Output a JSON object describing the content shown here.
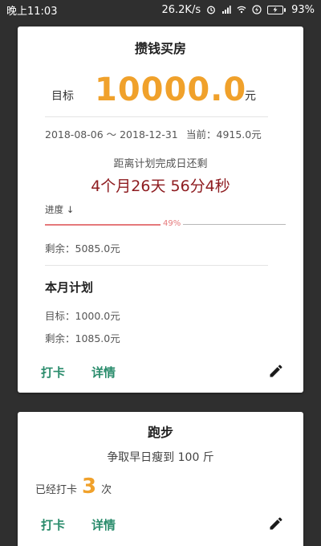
{
  "status_bar": {
    "time": "晚上11:03",
    "net_speed": "26.2K/s",
    "battery_pct": "93%"
  },
  "goal_card": {
    "title": "攒钱买房",
    "target_label": "目标",
    "target_amount": "10000.0",
    "target_unit": "元",
    "date_range": "2018-08-06 ～ 2018-12-31",
    "current": "当前：4915.0元",
    "remain_caption": "距离计划完成日还剩",
    "countdown": "4个月26天  56分4秒",
    "progress_label": "进度 ↓",
    "progress_percent": 49,
    "progress_text": "49%",
    "remaining": "剩余：5085.0元",
    "month_plan_title": "本月计划",
    "month_target": "目标：1000.0元",
    "month_remaining": "剩余：1085.0元",
    "checkin_label": "打卡",
    "detail_label": "详情"
  },
  "habit_card": {
    "title": "跑步",
    "motto": "争取早日瘦到 100 斤",
    "checked_prefix": "已经打卡",
    "checked_count": "3",
    "checked_suffix": "次",
    "checkin_label": "打卡",
    "detail_label": "详情"
  },
  "colors": {
    "accent_orange": "#f0a12b",
    "action_green": "#2a8c6c",
    "countdown_red": "#8e1c20",
    "progress_pink": "#e5797b"
  }
}
